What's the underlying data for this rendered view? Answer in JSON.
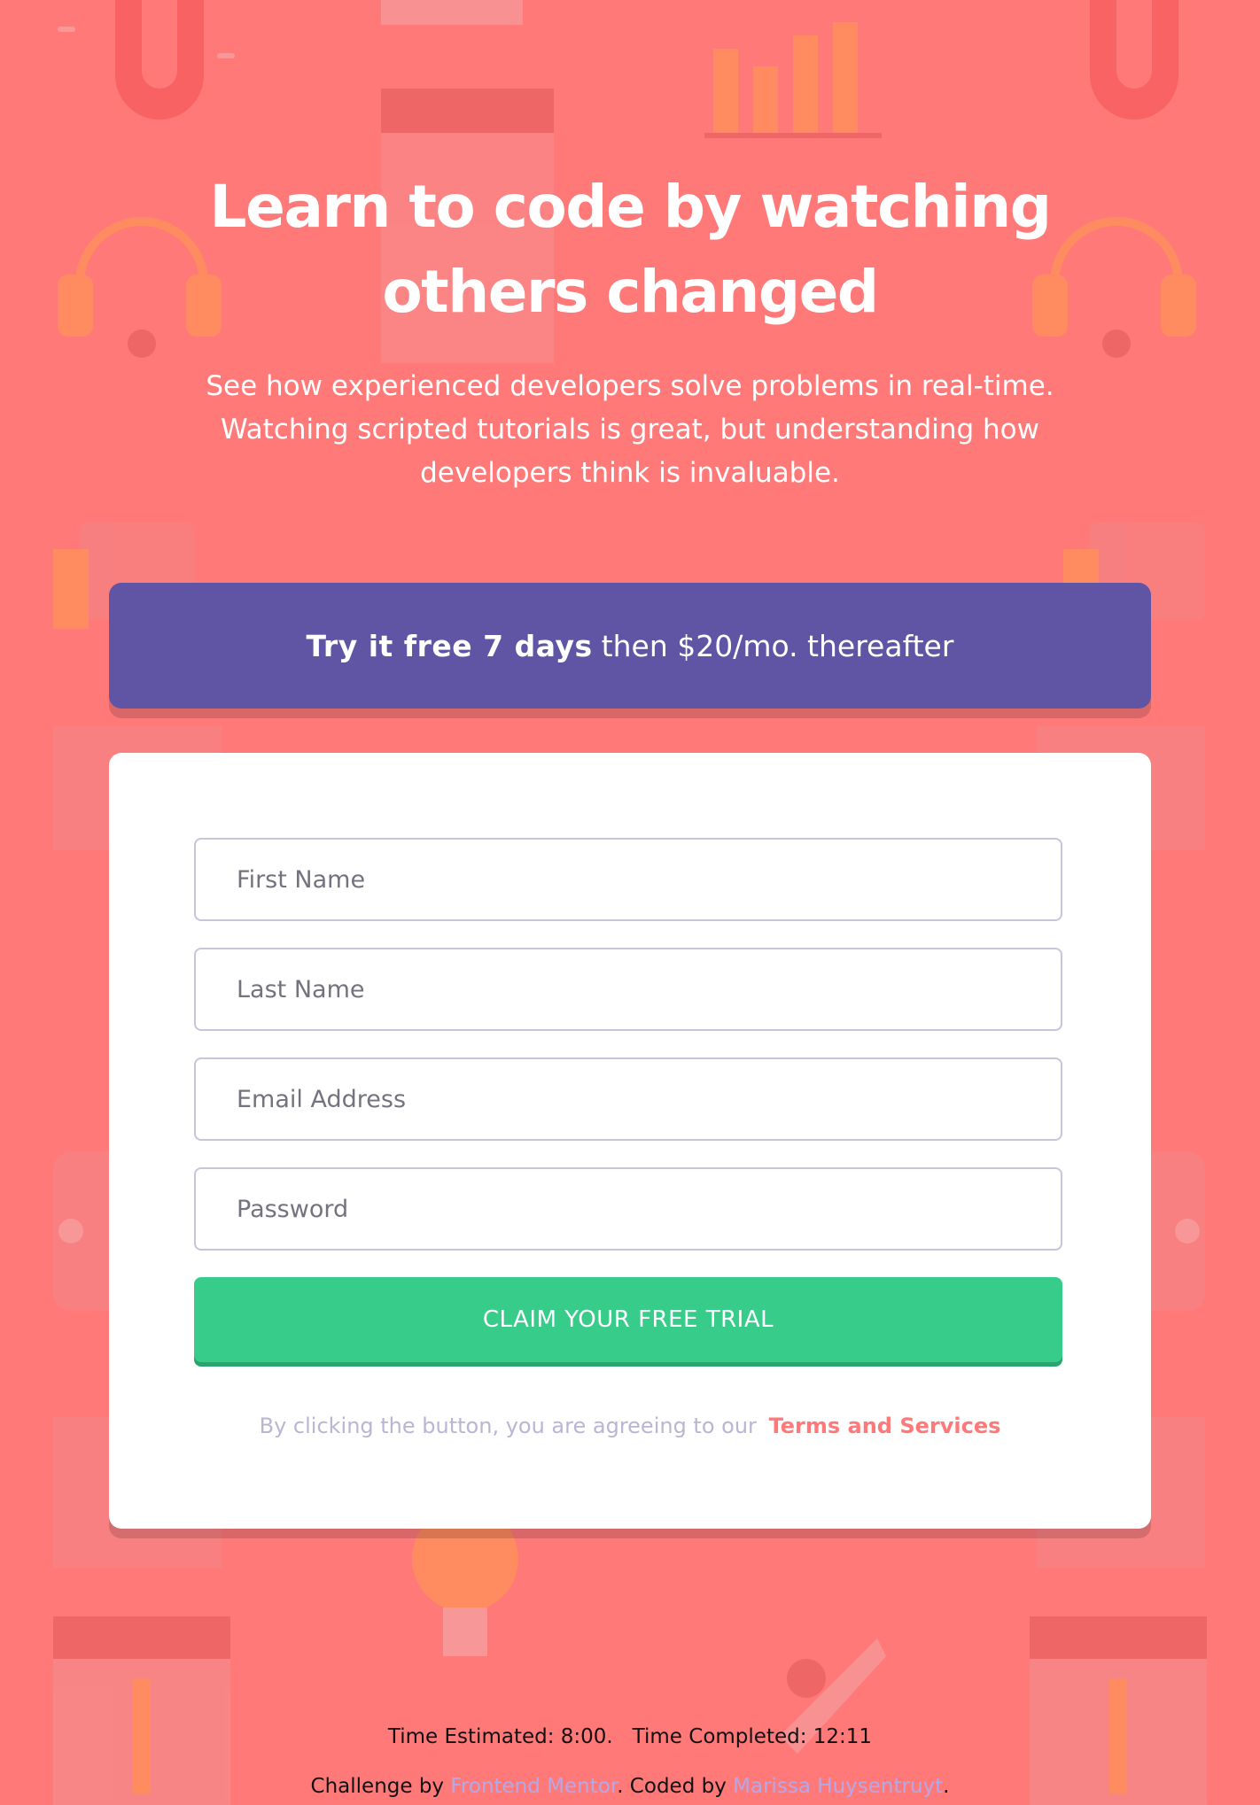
{
  "hero": {
    "title_line1": "Learn to code by watching",
    "title_line2": "others changed",
    "text_line1": "See how experienced developers solve problems in real-time.",
    "text_line2": "Watching scripted tutorials is great, but understanding how",
    "text_line3": "developers think is invaluable."
  },
  "promo": {
    "bold": "Try it free 7 days",
    "rest": "then $20/mo. thereafter"
  },
  "form": {
    "first_name_placeholder": "First Name",
    "last_name_placeholder": "Last Name",
    "email_placeholder": "Email Address",
    "password_placeholder": "Password",
    "submit_label": "CLAIM YOUR FREE TRIAL",
    "terms_text": "By clicking the button, you are agreeing to our",
    "terms_link": "Terms and Services"
  },
  "footer": {
    "time_estimated": "Time Estimated: 8:00.",
    "time_completed": "Time Completed: 12:11",
    "challenge_by": "Challenge by",
    "challenge_link": "Frontend Mentor",
    "coded_by": ". Coded by",
    "coder_link": "Marissa Huysentruyt",
    "end": "."
  },
  "colors": {
    "background": "#ff7979",
    "promo": "#6055a5",
    "button": "#38cc8b",
    "link": "#ff7979",
    "footer_link": "#b5a8e6"
  }
}
